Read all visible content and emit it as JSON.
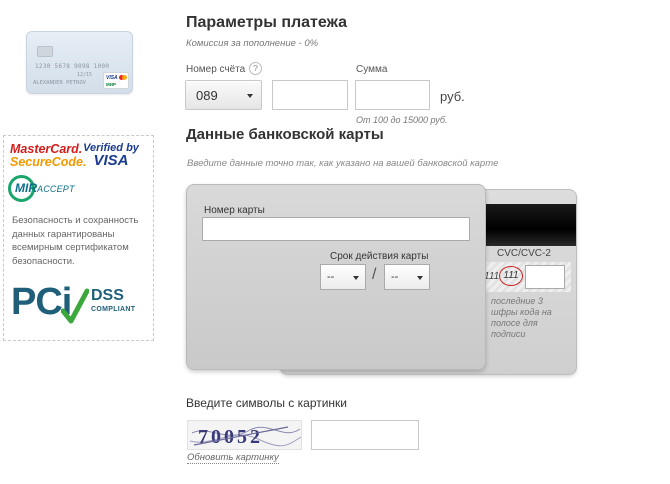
{
  "left_card": {
    "number": "1230 5678 9098 1000",
    "valid": "12/15",
    "holder": "ALEXANDER PETROV",
    "brand_visa": "VISA",
    "brand_mir": "МИР"
  },
  "security": {
    "mastercard_line1": "MasterCard.",
    "mastercard_line2": "SecureCode.",
    "verified_line1": "Verified by",
    "verified_line2": "VISA",
    "mir_text": "MIR",
    "mir_accept": "ACCEPT",
    "description": "Безопасность и сохранность данных гарантированы всемирным сертификатом безопасности.",
    "pci_text": "PCi",
    "dss_text": "DSS",
    "compliant_text": "COMPLIANT"
  },
  "payment": {
    "title": "Параметры платежа",
    "fee_note": "Комиссия за пополнение - 0%",
    "account_label": "Номер счёта",
    "help_icon_glyph": "?",
    "prefix_value": "089",
    "phone_value": "",
    "sum_label": "Сумма",
    "sum_value": "",
    "currency": "руб.",
    "sum_hint": "От 100 до 15000 руб."
  },
  "bank_card": {
    "title": "Данные банковской карты",
    "hint": "Введите данные точно так, как указано на вашей банковской карте",
    "card_number_label": "Номер карты",
    "card_number_value": "",
    "expiry_label": "Срок действия карты",
    "month_value": "--",
    "year_value": "--",
    "separator": "/",
    "cvc_title": "CVC/CVC-2",
    "cvc_sample_digits": "111",
    "cvc_highlight": "111",
    "cvc_value": "",
    "cvc_description": "последние 3 шфры кода на полосе для подписи"
  },
  "captcha": {
    "label": "Введите символы с картинки",
    "image_text": "70052",
    "input_value": "",
    "refresh_label": "Обновить картинку"
  },
  "colors": {
    "mastercard_red": "#d31d1d",
    "mastercard_orange": "#f29900",
    "visa_blue": "#1a3c8e",
    "mir_green": "#1aa56b",
    "pci_blue": "#1f5f7a",
    "cvc_circle_red": "#cc2222"
  }
}
